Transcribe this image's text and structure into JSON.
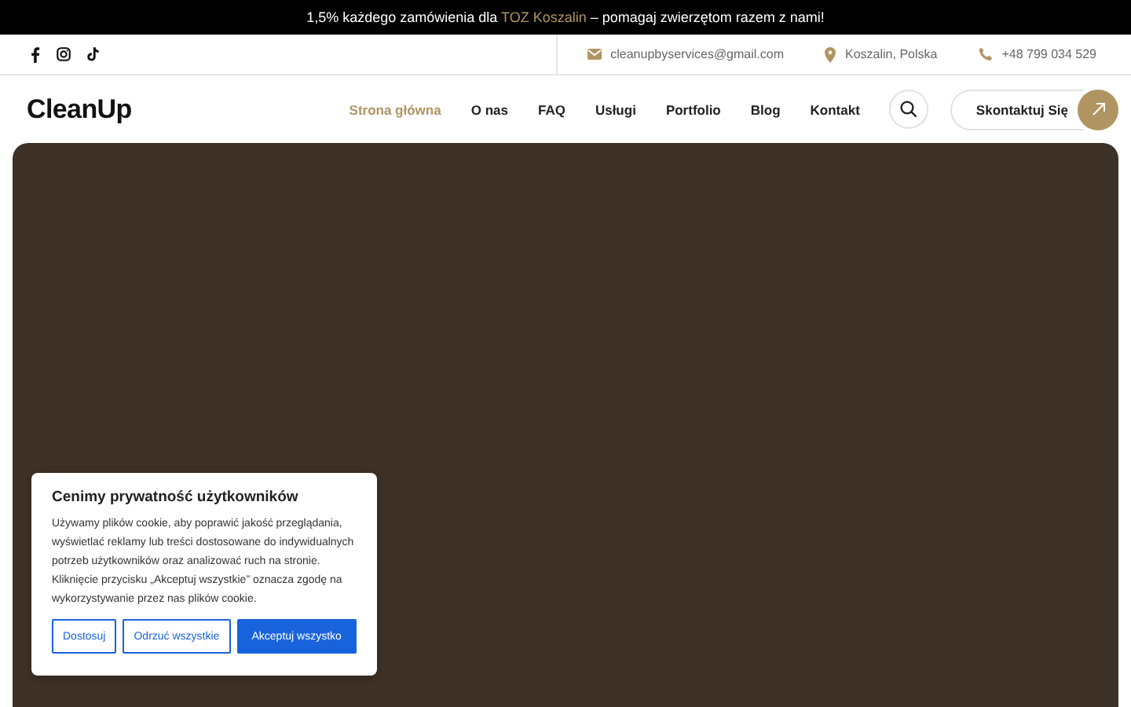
{
  "announcement": {
    "before": "1,5% każdego zamówienia dla ",
    "highlight": "TOZ Koszalin",
    "after": " – pomagaj zwierzętom razem z nami!"
  },
  "contact": {
    "email": "cleanupbyservices@gmail.com",
    "location": "Koszalin, Polska",
    "phone": "+48 799 034 529"
  },
  "logo": "CleanUp",
  "nav": [
    {
      "label": "Strona główna",
      "selected": true
    },
    {
      "label": "O nas",
      "selected": false
    },
    {
      "label": "FAQ",
      "selected": false
    },
    {
      "label": "Usługi",
      "selected": false
    },
    {
      "label": "Portfolio",
      "selected": false
    },
    {
      "label": "Blog",
      "selected": false
    },
    {
      "label": "Kontakt",
      "selected": false
    }
  ],
  "cta": "Skontaktuj Się",
  "cookie": {
    "title": "Cenimy prywatność użytkowników",
    "text": "Używamy plików cookie, aby poprawić jakość przeglądania, wyświetlać reklamy lub treści dostosowane do indywidualnych potrzeb użytkowników oraz analizować ruch na stronie. Kliknięcie przycisku „Akceptuj wszystkie” oznacza zgodę na wykorzystywanie przez nas plików cookie.",
    "buttons": [
      {
        "label": "Dostosuj",
        "kind": "outline"
      },
      {
        "label": "Odrzuć wszystkie",
        "kind": "outline"
      },
      {
        "label": "Akceptuj wszystko",
        "kind": "primary"
      }
    ]
  }
}
